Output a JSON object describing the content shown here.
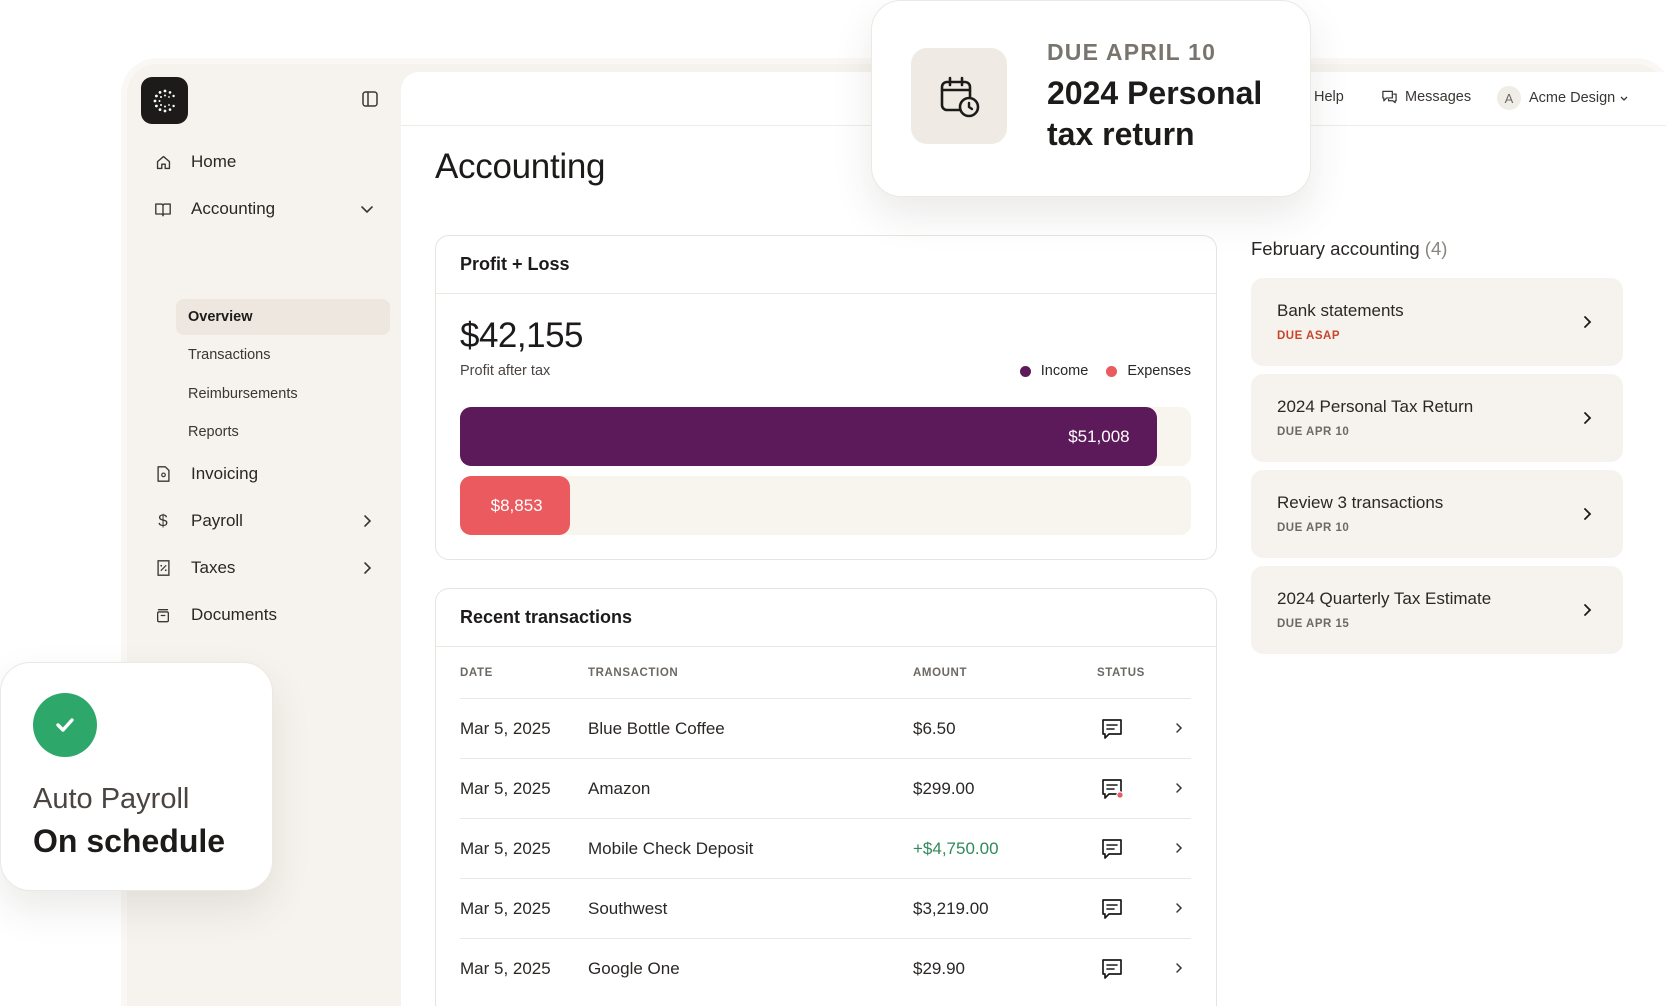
{
  "sidebar": {
    "nav": [
      {
        "label": "Home",
        "icon": "home-icon"
      },
      {
        "label": "Accounting",
        "icon": "book-icon",
        "expanded": true
      },
      {
        "label": "Invoicing",
        "icon": "invoice-icon"
      },
      {
        "label": "Payroll",
        "icon": "dollar-icon"
      },
      {
        "label": "Taxes",
        "icon": "receipt-icon"
      },
      {
        "label": "Documents",
        "icon": "archive-icon"
      }
    ],
    "sub": [
      {
        "label": "Overview",
        "active": true
      },
      {
        "label": "Transactions"
      },
      {
        "label": "Reimbursements"
      },
      {
        "label": "Reports"
      }
    ]
  },
  "topbar": {
    "help": "Help",
    "messages": "Messages",
    "avatar_initial": "A",
    "account": "Acme Design"
  },
  "page": {
    "title": "Accounting"
  },
  "profit_loss": {
    "title": "Profit + Loss",
    "amount": "$42,155",
    "subtitle": "Profit after tax",
    "legend": [
      {
        "label": "Income",
        "color": "#5c1a5a"
      },
      {
        "label": "Expenses",
        "color": "#ea5a5e"
      }
    ],
    "income": {
      "label": "$51,008",
      "fraction": 0.953
    },
    "expenses": {
      "label": "$8,853",
      "fraction": 0.15
    }
  },
  "recent": {
    "title": "Recent transactions",
    "columns": [
      "DATE",
      "TRANSACTION",
      "AMOUNT",
      "STATUS"
    ],
    "rows": [
      {
        "date": "Mar 5, 2025",
        "name": "Blue Bottle Coffee",
        "amount": "$6.50",
        "positive": false,
        "unread": false
      },
      {
        "date": "Mar 5, 2025",
        "name": "Amazon",
        "amount": "$299.00",
        "positive": false,
        "unread": true
      },
      {
        "date": "Mar 5, 2025",
        "name": "Mobile Check Deposit",
        "amount": "+$4,750.00",
        "positive": true,
        "unread": false
      },
      {
        "date": "Mar 5, 2025",
        "name": "Southwest",
        "amount": "$3,219.00",
        "positive": false,
        "unread": false
      },
      {
        "date": "Mar 5, 2025",
        "name": "Google One",
        "amount": "$29.90",
        "positive": false,
        "unread": false
      }
    ]
  },
  "february": {
    "title": "February accounting",
    "count": "(4)",
    "items": [
      {
        "title": "Bank statements",
        "due": "DUE ASAP",
        "urgent": true
      },
      {
        "title": "2024 Personal Tax Return",
        "due": "DUE APR 10",
        "urgent": false
      },
      {
        "title": "Review 3 transactions",
        "due": "DUE APR 10",
        "urgent": false
      },
      {
        "title": "2024 Quarterly Tax Estimate",
        "due": "DUE APR 15",
        "urgent": false
      }
    ]
  },
  "tax_popup": {
    "due": "DUE APRIL 10",
    "title": "2024 Personal tax return"
  },
  "payroll_popup": {
    "label": "Auto Payroll",
    "status": "On schedule"
  },
  "colors": {
    "income": "#5c1a5a",
    "expenses": "#ea5a5e",
    "positive": "#2f8a5b",
    "urgent": "#c8452c",
    "success": "#2ea86a"
  }
}
